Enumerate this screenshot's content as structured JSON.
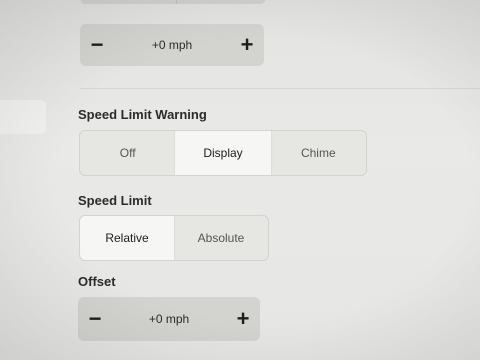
{
  "top_offset": {
    "minus_label": "−",
    "value": "+0 mph",
    "plus_label": "+"
  },
  "speed_limit_warning": {
    "label": "Speed Limit Warning",
    "options": [
      "Off",
      "Display",
      "Chime"
    ],
    "selected": "Display"
  },
  "speed_limit": {
    "label": "Speed Limit",
    "options": [
      "Relative",
      "Absolute"
    ],
    "selected": "Relative"
  },
  "offset": {
    "label": "Offset",
    "minus_label": "−",
    "value": "+0 mph",
    "plus_label": "+"
  }
}
